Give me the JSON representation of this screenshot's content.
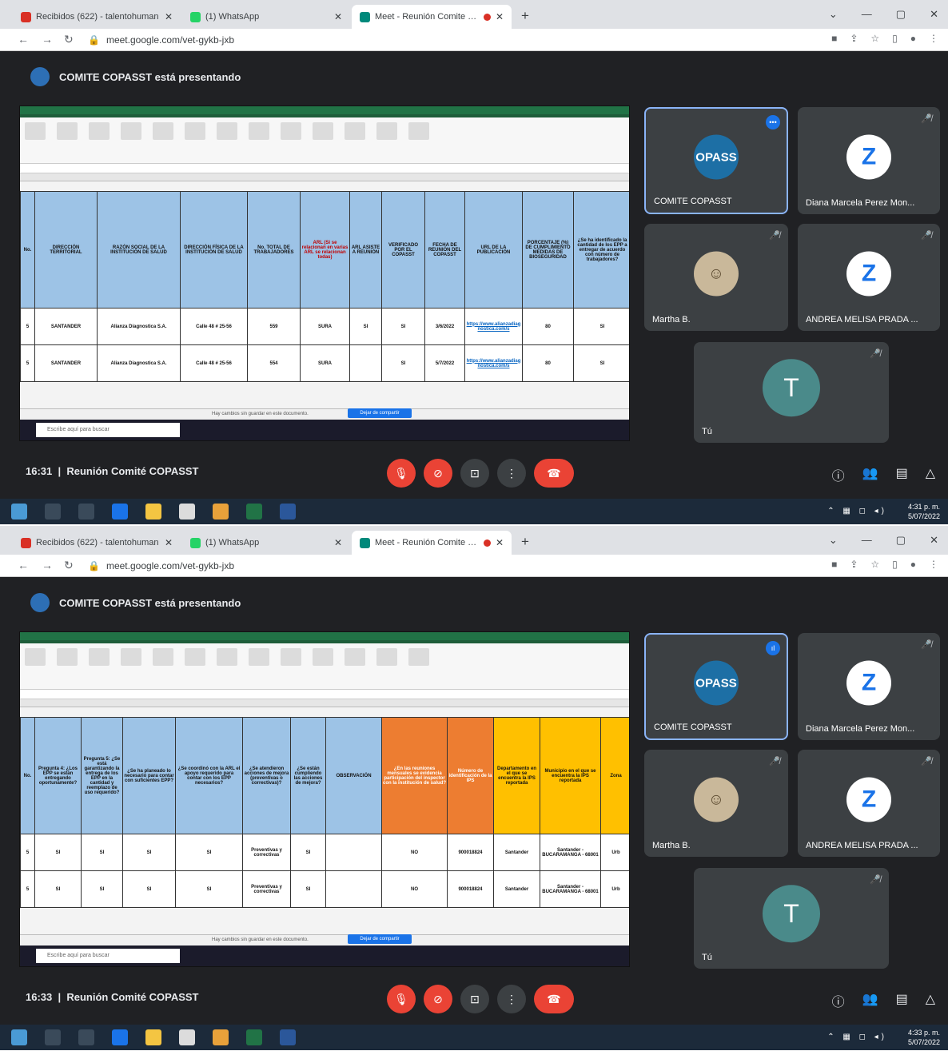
{
  "browser": {
    "tabs": [
      {
        "label": "Recibidos (622) - talentohuman",
        "icon_color": "#d93025"
      },
      {
        "label": "(1) WhatsApp",
        "icon_color": "#25d366"
      },
      {
        "label": "Meet - Reunión Comite COPASST",
        "icon_color": "#00897b"
      }
    ],
    "url": "meet.google.com/vet-gykb-jxb"
  },
  "meet": {
    "presenting_label": "COMITE COPASST está presentando",
    "meeting_name": "Reunión Comité COPASST",
    "participants": [
      {
        "name": "COMITE COPASST",
        "avatar_text": "OPASS"
      },
      {
        "name": "Diana Marcela Perez Mon...",
        "avatar_text": "Z"
      },
      {
        "name": "Martha B.",
        "avatar_text": "☺"
      },
      {
        "name": "ANDREA MELISA PRADA ...",
        "avatar_text": "Z"
      },
      {
        "name": "Tú",
        "avatar_text": "T"
      }
    ]
  },
  "excel": {
    "notice": "Hay cambios sin guardar en este documento.",
    "keep_button": "Dejar de compartir",
    "search_placeholder": "Escribe aquí para buscar"
  },
  "shot1": {
    "time": "16:31",
    "clock_time": "4:31 p. m.",
    "clock_date": "5/07/2022",
    "headers": [
      "No.",
      "DIRECCIÓN TERRITORIAL",
      "RAZÓN SOCIAL DE LA INSTITUCIÓN DE SALUD",
      "DIRECCIÓN FÍSICA DE LA INSTITUCIÓN DE SALUD",
      "No. TOTAL DE TRABAJADORES",
      "ARL (Si se relacionan en varias ARL se relacionan todas)",
      "ARL ASISTE A REUNIÓN",
      "VERIFICADO POR EL COPASST",
      "FECHA DE REUNIÓN DEL COPASST",
      "URL DE LA PUBLICACIÓN",
      "PORCENTAJE (%) DE CUMPLIMIENTO MEDIDAS DE BIOSEGURIDAD",
      "¿Se ha identificado la cantidad de los EPP a entregar de acuerdo con número de trabajadores?"
    ],
    "rows": [
      [
        "5",
        "SANTANDER",
        "Alianza Diagnostica S.A.",
        "Calle 48 # 25-56",
        "559",
        "SURA",
        "SI",
        "SI",
        "3/6/2022",
        "https://www.alianzadiagnostica.com/s",
        "80",
        "SI"
      ],
      [
        "5",
        "SANTANDER",
        "Alianza Diagnostica S.A.",
        "Calle 48 # 25-56",
        "554",
        "SURA",
        "",
        "SI",
        "5/7/2022",
        "https://www.alianzadiagnostica.com/s",
        "80",
        "SI"
      ]
    ]
  },
  "shot2": {
    "time": "16:33",
    "clock_time": "4:33 p. m.",
    "clock_date": "5/07/2022",
    "headers": [
      "No.",
      "Pregunta 4: ¿Los EPP se están entregando oportunamente?",
      "Pregunta 5: ¿Se está garantizando la entrega de los EPP en la cantidad y reemplazo de uso requerido?",
      "¿Se ha planeado lo necesario para contar con suficientes EPP?",
      "¿Se coordinó con la ARL el apoyo requerido para contar con los EPP necesarios?",
      "¿Se atendieron acciones de mejora (preventivas o correctivas)?",
      "¿Se están cumpliendo las acciones de mejora?",
      "OBSERVACIÓN",
      "¿En las reuniones mensuales se evidencia participación del inspector con la institución de salud?",
      "Número de identificación de la IPS",
      "Departamento en el que se encuentra la IPS reportada",
      "Municipio en el que se encuentra la IPS reportada",
      "Zona"
    ],
    "rows": [
      [
        "5",
        "SI",
        "SI",
        "SI",
        "SI",
        "Preventivas y correctivas",
        "SI",
        "",
        "NO",
        "900018824",
        "Santander",
        "Santander - BUCARAMANGA - 68001",
        "Urb"
      ],
      [
        "5",
        "SI",
        "SI",
        "SI",
        "SI",
        "Preventivas y correctivas",
        "SI",
        "",
        "NO",
        "900018824",
        "Santander",
        "Santander - BUCARAMANGA - 68001",
        "Urb"
      ]
    ]
  }
}
